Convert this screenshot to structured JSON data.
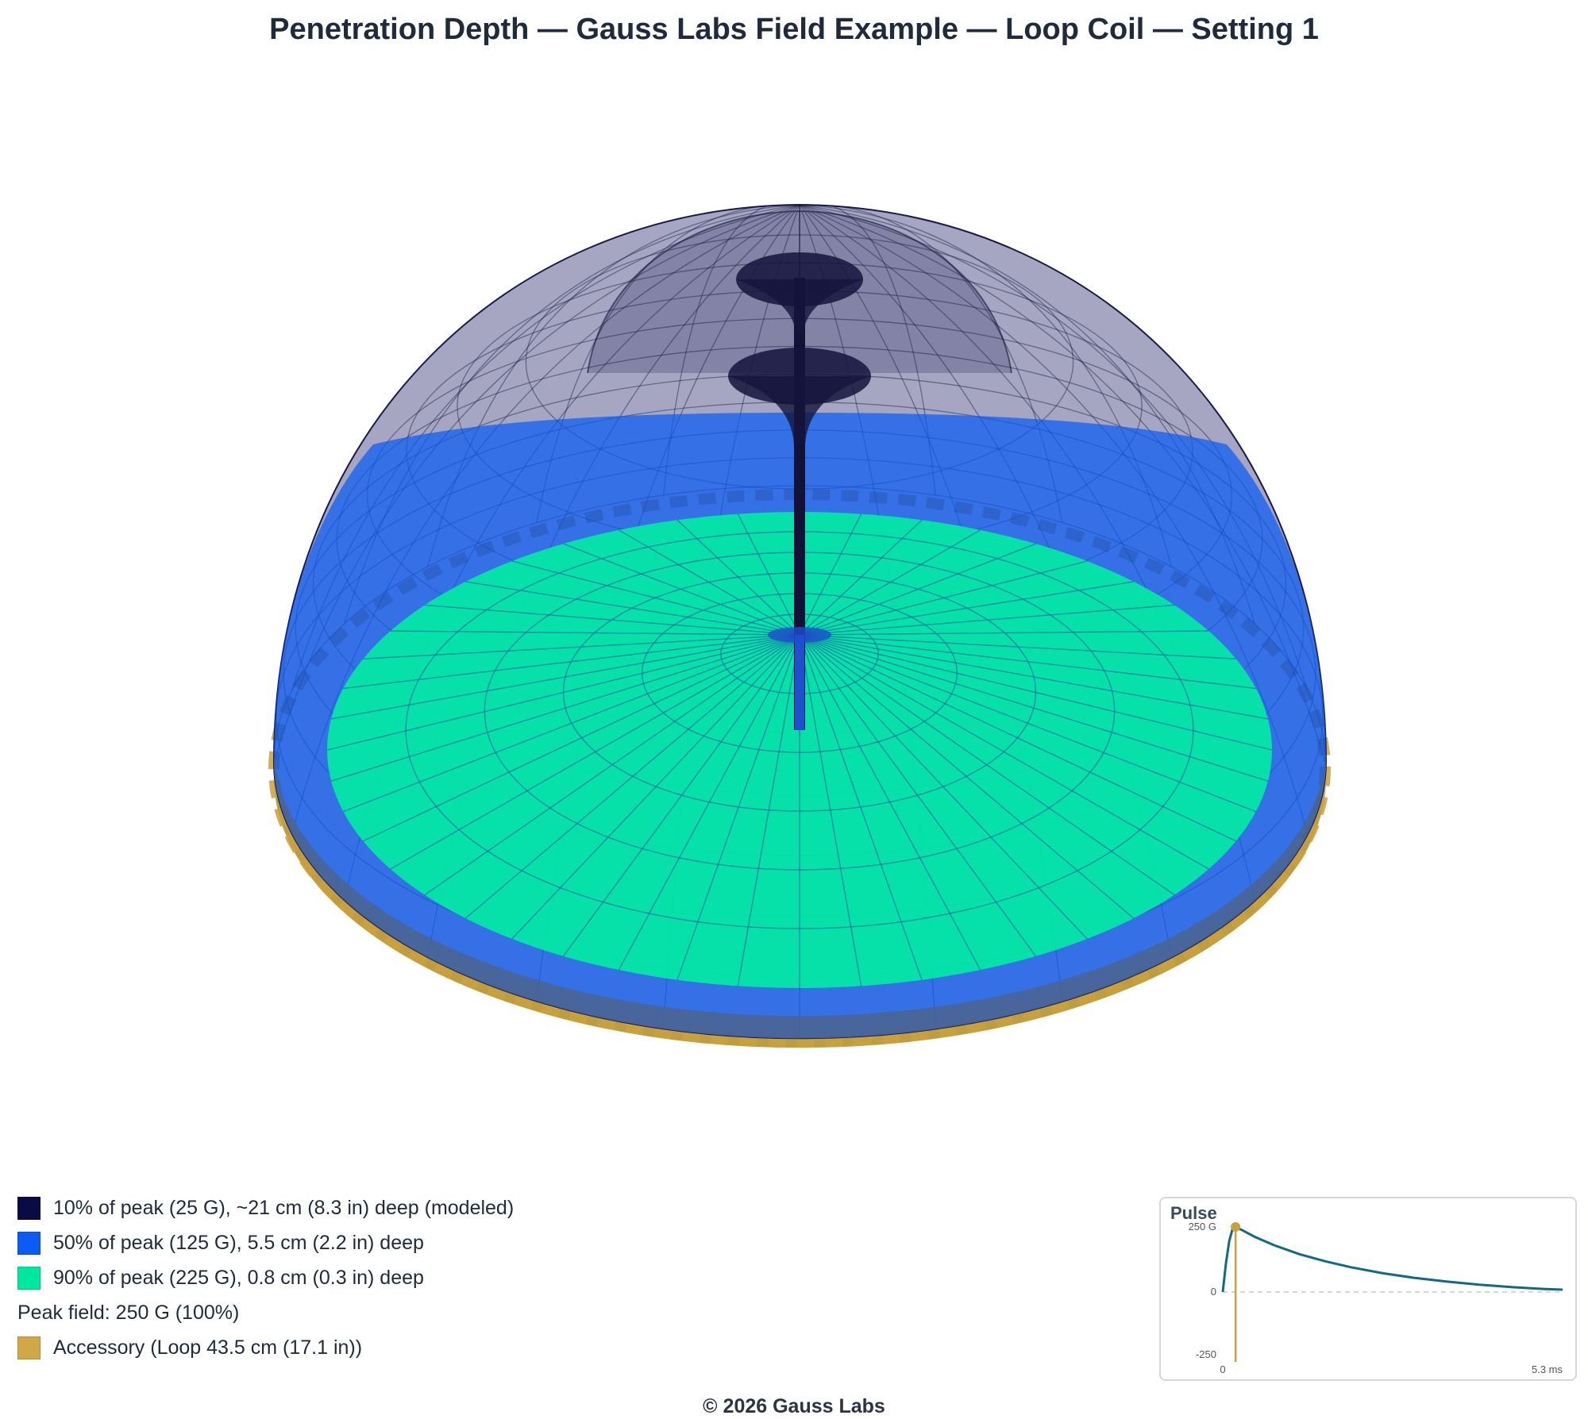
{
  "title": "Penetration Depth — Gauss Labs Field Example — Loop Coil — Setting 1",
  "colors": {
    "outer_shell": "#0a0a45",
    "mid_shell": "#0a5cf5",
    "inner_disk": "#00f0a0",
    "accessory": "#c9a13c",
    "pulse_line": "#0e6a86"
  },
  "legend": {
    "items": [
      {
        "label": "10% of peak (25 G), ~21 cm (8.3 in) deep (modeled)",
        "color": "#0a0a45"
      },
      {
        "label": "50% of peak (125 G), 5.5 cm (2.2 in) deep",
        "color": "#0a5cf5"
      },
      {
        "label": "90% of peak (225 G), 0.8 cm (0.3 in) deep",
        "color": "#00e8a0"
      }
    ],
    "peak_text": "Peak field: 250 G (100%)",
    "accessory": {
      "label": "Accessory (Loop 43.5 cm (17.1 in))",
      "color": "#d0a845"
    }
  },
  "pulse": {
    "title": "Pulse",
    "y_max_label": "250 G",
    "y_zero_label": "0",
    "y_min_label": "-250",
    "x_start_label": "0",
    "x_end_label": "5.3 ms"
  },
  "chart_data": {
    "type": "line",
    "title": "Pulse",
    "xlabel": "",
    "ylabel": "",
    "xlim": [
      0,
      5.3
    ],
    "ylim": [
      -250,
      250
    ],
    "marker": {
      "x": 0.2,
      "y": 250
    },
    "series": [
      {
        "x": [
          0,
          0.05,
          0.1,
          0.15,
          0.2,
          0.3,
          0.5,
          0.8,
          1.2,
          1.6,
          2.0,
          2.5,
          3.0,
          3.5,
          4.0,
          4.5,
          5.0,
          5.3
        ],
        "values": [
          0,
          110,
          195,
          240,
          250,
          238,
          212,
          180,
          145,
          118,
          95,
          72,
          54,
          40,
          28,
          19,
          12,
          9
        ]
      }
    ]
  },
  "footer": "© 2026 Gauss Labs"
}
